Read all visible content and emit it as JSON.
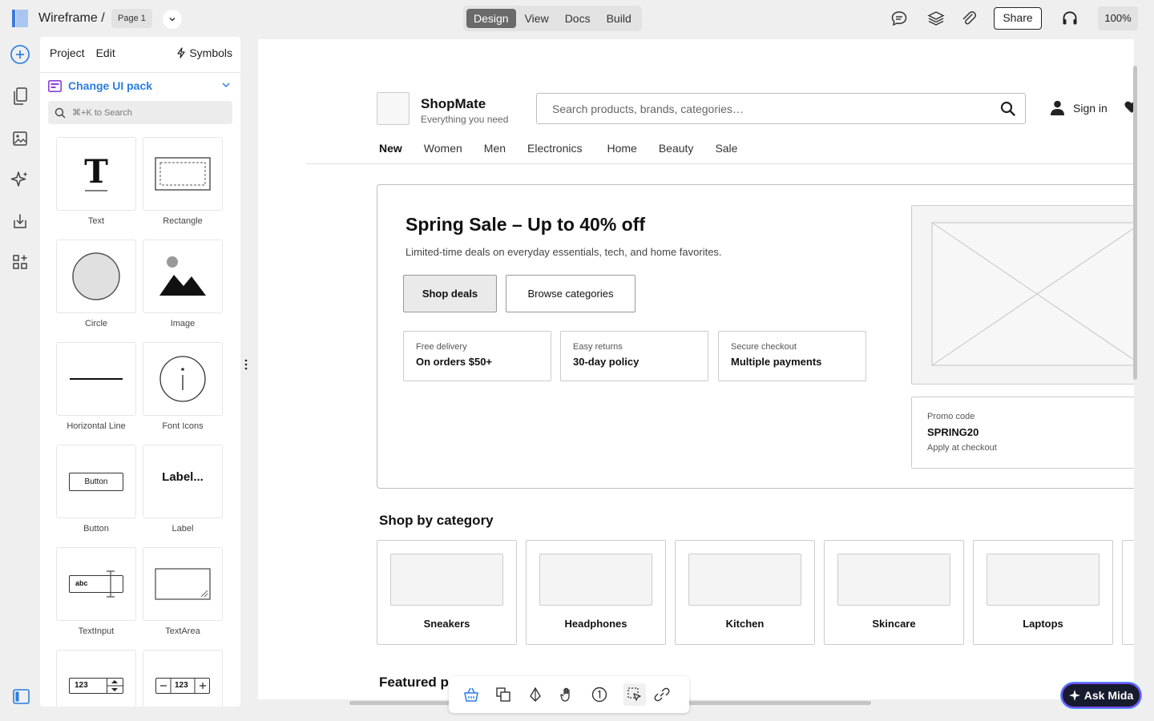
{
  "app": {
    "title": "Wireframe /",
    "page": "Page 1"
  },
  "mode_tabs": [
    {
      "label": "Design",
      "active": true
    },
    {
      "label": "View",
      "active": false
    },
    {
      "label": "Docs",
      "active": false
    },
    {
      "label": "Build",
      "active": false
    }
  ],
  "header": {
    "share_label": "Share",
    "zoom": "100%"
  },
  "panel": {
    "menu": [
      "Project",
      "Edit"
    ],
    "symbols_label": "Symbols",
    "ui_pack_label": "Change UI pack",
    "search_placeholder": "⌘+K to Search",
    "components": [
      {
        "label": "Text",
        "icon": "text-t-icon"
      },
      {
        "label": "Rectangle",
        "icon": "rectangle-icon"
      },
      {
        "label": "Circle",
        "icon": "circle-icon"
      },
      {
        "label": "Image",
        "icon": "image-icon"
      },
      {
        "label": "Horizontal Line",
        "icon": "line-icon"
      },
      {
        "label": "Font Icons",
        "icon": "info-icon"
      },
      {
        "label": "Button",
        "icon": "button-icon",
        "preview": "Button"
      },
      {
        "label": "Label",
        "icon": "label-icon",
        "preview": "Label..."
      },
      {
        "label": "TextInput",
        "icon": "text-input-icon",
        "preview": "abc"
      },
      {
        "label": "TextArea",
        "icon": "textarea-icon"
      },
      {
        "label": "",
        "icon": "stepper-icon",
        "preview": "123"
      },
      {
        "label": "",
        "icon": "number-stepper-icon",
        "preview": "123"
      }
    ]
  },
  "wireframe": {
    "brand_name": "ShopMate",
    "brand_tagline": "Everything you need",
    "search_placeholder": "Search products, brands, categories…",
    "signin_label": "Sign in",
    "nav": [
      "New",
      "Women",
      "Men",
      "Electronics",
      "Home",
      "Beauty",
      "Sale"
    ],
    "hero": {
      "title": "Spring Sale – Up to 40% off",
      "subtitle": "Limited-time deals on everyday essentials, tech, and home favorites.",
      "primary_cta": "Shop deals",
      "secondary_cta": "Browse categories",
      "features": [
        {
          "label": "Free delivery",
          "value": "On orders $50+"
        },
        {
          "label": "Easy returns",
          "value": "30-day policy"
        },
        {
          "label": "Secure checkout",
          "value": "Multiple payments"
        }
      ],
      "promo": {
        "label": "Promo code",
        "code": "SPRING20",
        "note": "Apply at checkout"
      }
    },
    "categories_title": "Shop by category",
    "categories": [
      "Sneakers",
      "Headphones",
      "Kitchen",
      "Skincare",
      "Laptops"
    ],
    "featured_title": "Featured pr"
  },
  "ask_label": "Ask Mida",
  "colors": {
    "accent": "#2a7de1",
    "mode_active": "#6a6a6a",
    "ask_bg": "#171b2e",
    "ask_border": "#7a4dff"
  }
}
